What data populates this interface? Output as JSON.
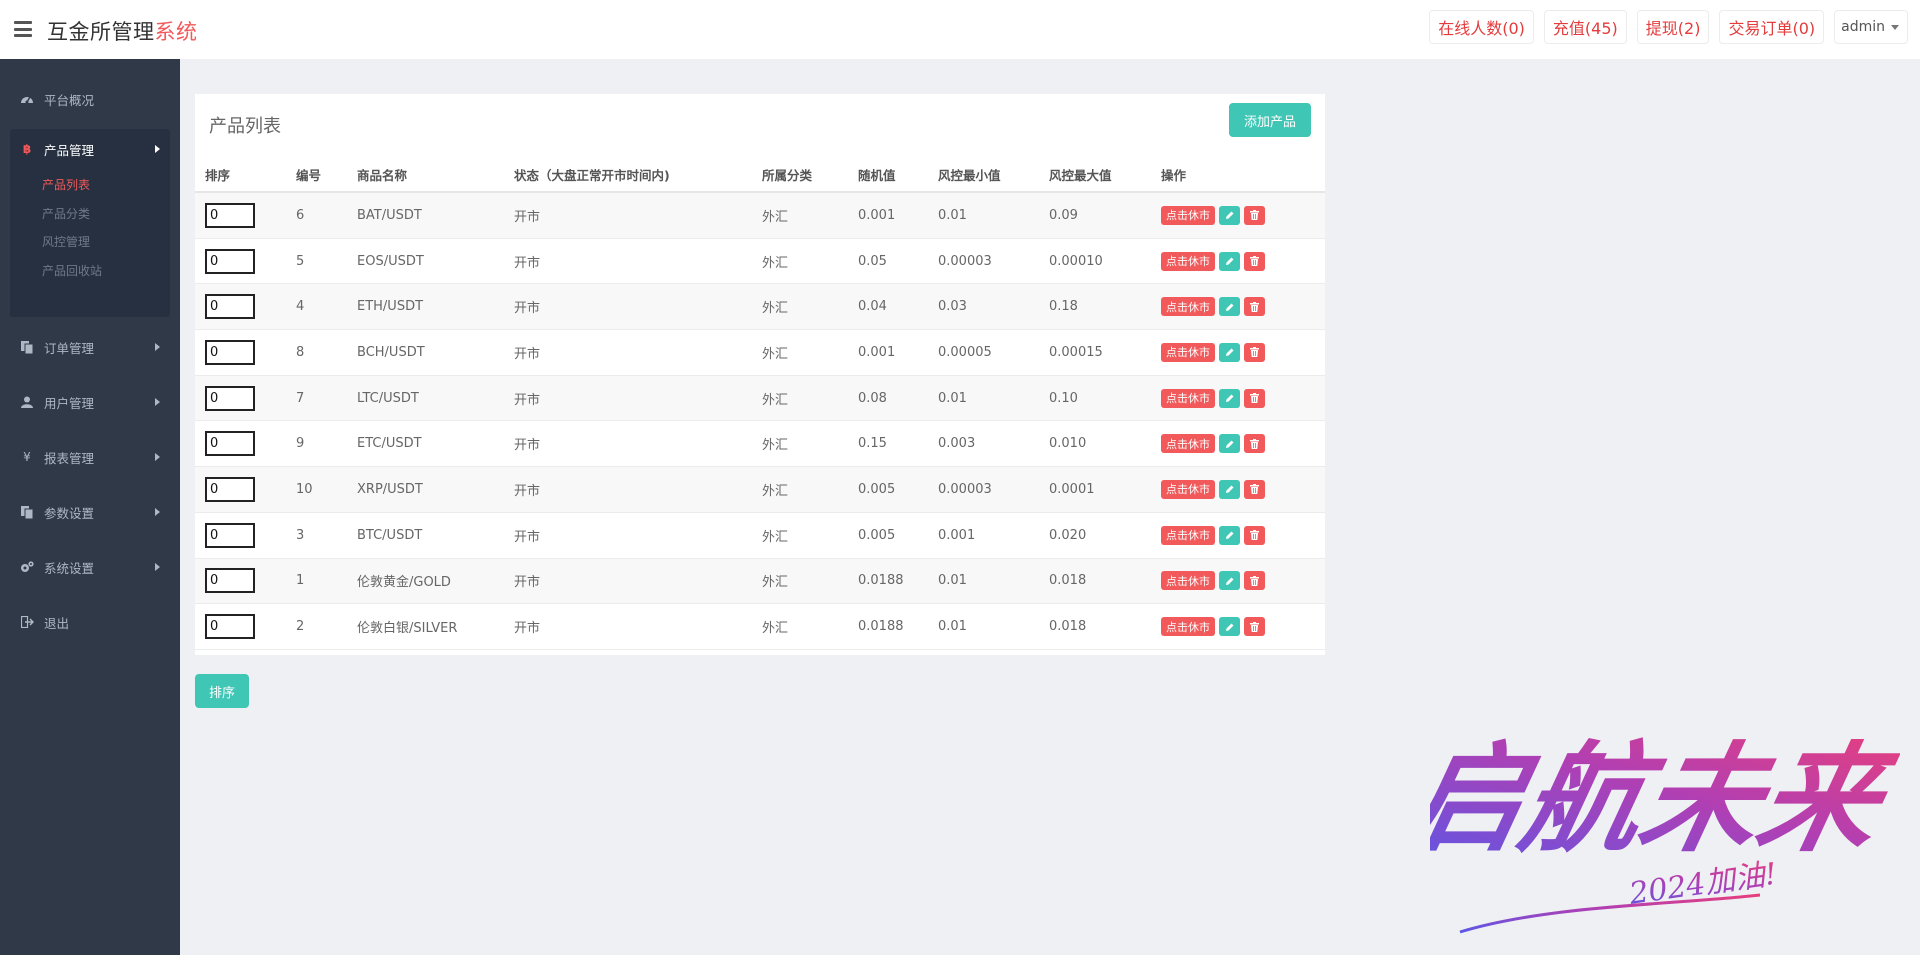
{
  "header": {
    "brand_main": "互金所管理",
    "brand_accent": "系统",
    "stats": [
      {
        "label": "在线人数(0)"
      },
      {
        "label": "充值(45)"
      },
      {
        "label": "提现(2)"
      },
      {
        "label": "交易订单(0)"
      }
    ],
    "user": "admin"
  },
  "sidebar": {
    "overview": "平台概况",
    "product_group": {
      "label": "产品管理",
      "items": [
        "产品列表",
        "产品分类",
        "风控管理",
        "产品回收站"
      ],
      "active_index": 0
    },
    "menus": [
      "订单管理",
      "用户管理",
      "报表管理",
      "参数设置",
      "系统设置"
    ],
    "logout": "退出"
  },
  "panel": {
    "title": "产品列表",
    "add_button": "添加产品",
    "columns": [
      "排序",
      "编号",
      "商品名称",
      "状态（大盘正常开市时间内)",
      "所属分类",
      "随机值",
      "风控最小值",
      "风控最大值",
      "操作"
    ],
    "rows": [
      {
        "sort": "0",
        "id": "6",
        "name": "BAT/USDT",
        "status": "开市",
        "category": "外汇",
        "random": "0.001",
        "min": "0.01",
        "max": "0.09",
        "action": "点击休市"
      },
      {
        "sort": "0",
        "id": "5",
        "name": "EOS/USDT",
        "status": "开市",
        "category": "外汇",
        "random": "0.05",
        "min": "0.00003",
        "max": "0.00010",
        "action": "点击休市"
      },
      {
        "sort": "0",
        "id": "4",
        "name": "ETH/USDT",
        "status": "开市",
        "category": "外汇",
        "random": "0.04",
        "min": "0.03",
        "max": "0.18",
        "action": "点击休市"
      },
      {
        "sort": "0",
        "id": "8",
        "name": "BCH/USDT",
        "status": "开市",
        "category": "外汇",
        "random": "0.001",
        "min": "0.00005",
        "max": "0.00015",
        "action": "点击休市"
      },
      {
        "sort": "0",
        "id": "7",
        "name": "LTC/USDT",
        "status": "开市",
        "category": "外汇",
        "random": "0.08",
        "min": "0.01",
        "max": "0.10",
        "action": "点击休市"
      },
      {
        "sort": "0",
        "id": "9",
        "name": "ETC/USDT",
        "status": "开市",
        "category": "外汇",
        "random": "0.15",
        "min": "0.003",
        "max": "0.010",
        "action": "点击休市"
      },
      {
        "sort": "0",
        "id": "10",
        "name": "XRP/USDT",
        "status": "开市",
        "category": "外汇",
        "random": "0.005",
        "min": "0.00003",
        "max": "0.0001",
        "action": "点击休市"
      },
      {
        "sort": "0",
        "id": "3",
        "name": "BTC/USDT",
        "status": "开市",
        "category": "外汇",
        "random": "0.005",
        "min": "0.001",
        "max": "0.020",
        "action": "点击休市"
      },
      {
        "sort": "0",
        "id": "1",
        "name": "伦敦黄金/GOLD",
        "status": "开市",
        "category": "外汇",
        "random": "0.0188",
        "min": "0.01",
        "max": "0.018",
        "action": "点击休市"
      },
      {
        "sort": "0",
        "id": "2",
        "name": "伦敦白银/SILVER",
        "status": "开市",
        "category": "外汇",
        "random": "0.0188",
        "min": "0.01",
        "max": "0.018",
        "action": "点击休市"
      }
    ],
    "sort_button": "排序"
  },
  "watermark": {
    "main": "启航未来",
    "sub": "2024加油!"
  },
  "colors": {
    "accent_red": "#f1595a",
    "teal": "#3fc6b4",
    "sidebar_bg": "#2f3947"
  }
}
